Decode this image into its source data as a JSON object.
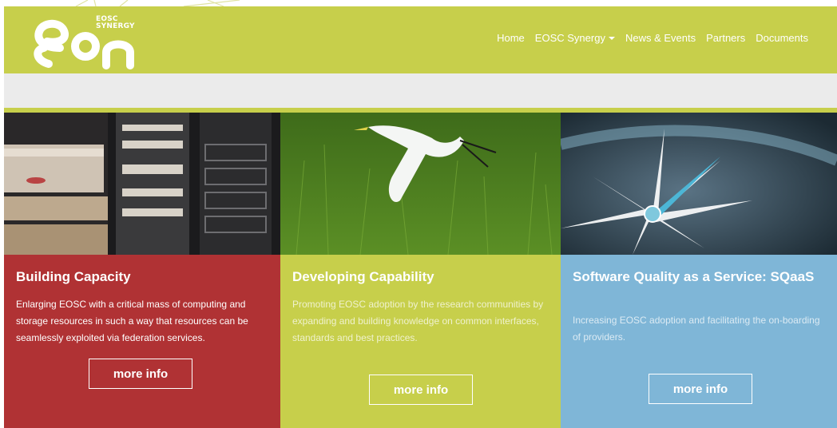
{
  "brand": {
    "line1": "EOSC",
    "line2": "SYNERGY",
    "logo_icon": "eosc-synergy-logo"
  },
  "nav": {
    "items": [
      {
        "label": "Home"
      },
      {
        "label": "EOSC Synergy",
        "has_dropdown": true
      },
      {
        "label": "News & Events"
      },
      {
        "label": "Partners"
      },
      {
        "label": "Documents"
      }
    ]
  },
  "colors": {
    "brand_green": "#c7cf4b",
    "red": "#b03234",
    "blue": "#7fb6d7",
    "grey_bar": "#ebebeb"
  },
  "cards": [
    {
      "title": "Building Capacity",
      "text": "Enlarging EOSC with a critical mass of computing and storage resources in such a way that resources can be seamlessly exploited via federation services.",
      "button": "more info",
      "image": "server-racks-photo"
    },
    {
      "title": "Developing Capability",
      "text": "Promoting EOSC adoption by the research communities by expanding and building knowledge on common interfaces, standards and best practices.",
      "button": "more info",
      "image": "egret-flying-over-grass-photo"
    },
    {
      "title": "Software Quality as a Service: SQaaS",
      "text": "Increasing EOSC adoption and facilitating the on-boarding of providers.",
      "button": "more info",
      "image": "quality-compass-photo"
    }
  ]
}
